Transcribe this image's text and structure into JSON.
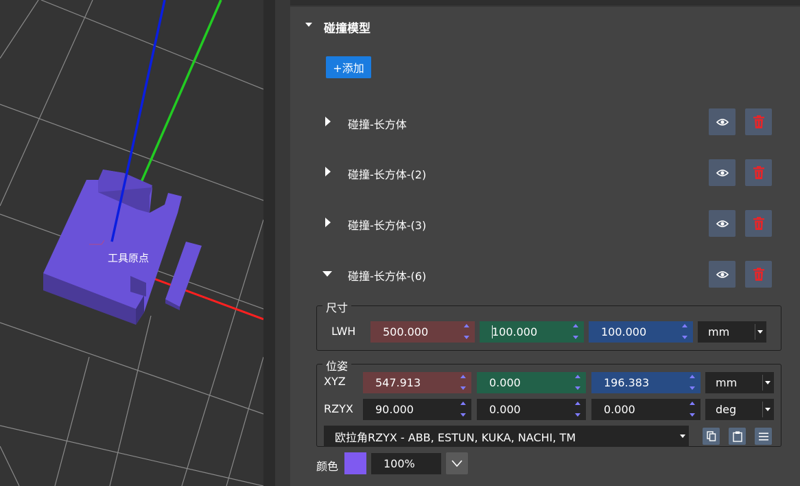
{
  "viewport": {
    "origin_label": "工具原点"
  },
  "panel": {
    "section_title": "碰撞模型",
    "add_label": "+添加",
    "items": [
      {
        "label": "碰撞-长方体",
        "expanded": false,
        "view_icon": "eye-icon",
        "delete_icon": "trash-icon"
      },
      {
        "label": "碰撞-长方体-(2)",
        "expanded": false,
        "view_icon": "eye-icon",
        "delete_icon": "trash-icon"
      },
      {
        "label": "碰撞-长方体-(3)",
        "expanded": false,
        "view_icon": "eye-icon",
        "delete_icon": "trash-icon"
      },
      {
        "label": "碰撞-长方体-(6)",
        "expanded": true,
        "view_icon": "eye-icon",
        "delete_icon": "trash-icon"
      }
    ]
  },
  "size": {
    "legend": "尺寸",
    "label": "LWH",
    "l": "500.000",
    "w": "100.000",
    "h": "100.000",
    "unit": "mm"
  },
  "pose": {
    "legend": "位姿",
    "xyz_label": "XYZ",
    "x": "547.913",
    "y": "0.000",
    "z": "196.383",
    "xyz_unit": "mm",
    "rot_label": "RZYX",
    "rz": "90.000",
    "ry": "0.000",
    "rx": "0.000",
    "rot_unit": "deg",
    "euler_convention": "欧拉角RZYX - ABB, ESTUN, KUKA, NACHI, TM",
    "tools": [
      "copy-icon",
      "paste-icon",
      "menu-icon"
    ]
  },
  "color": {
    "label": "颜色",
    "swatch": "#7f5af0",
    "opacity": "100%"
  },
  "colors": {
    "accent": "#1a7ce0",
    "x_axis": "#ff2020",
    "y_axis": "#22cc22",
    "z_axis": "#0a1ee0",
    "model": "#6a52d8",
    "delete": "#e5262a"
  }
}
